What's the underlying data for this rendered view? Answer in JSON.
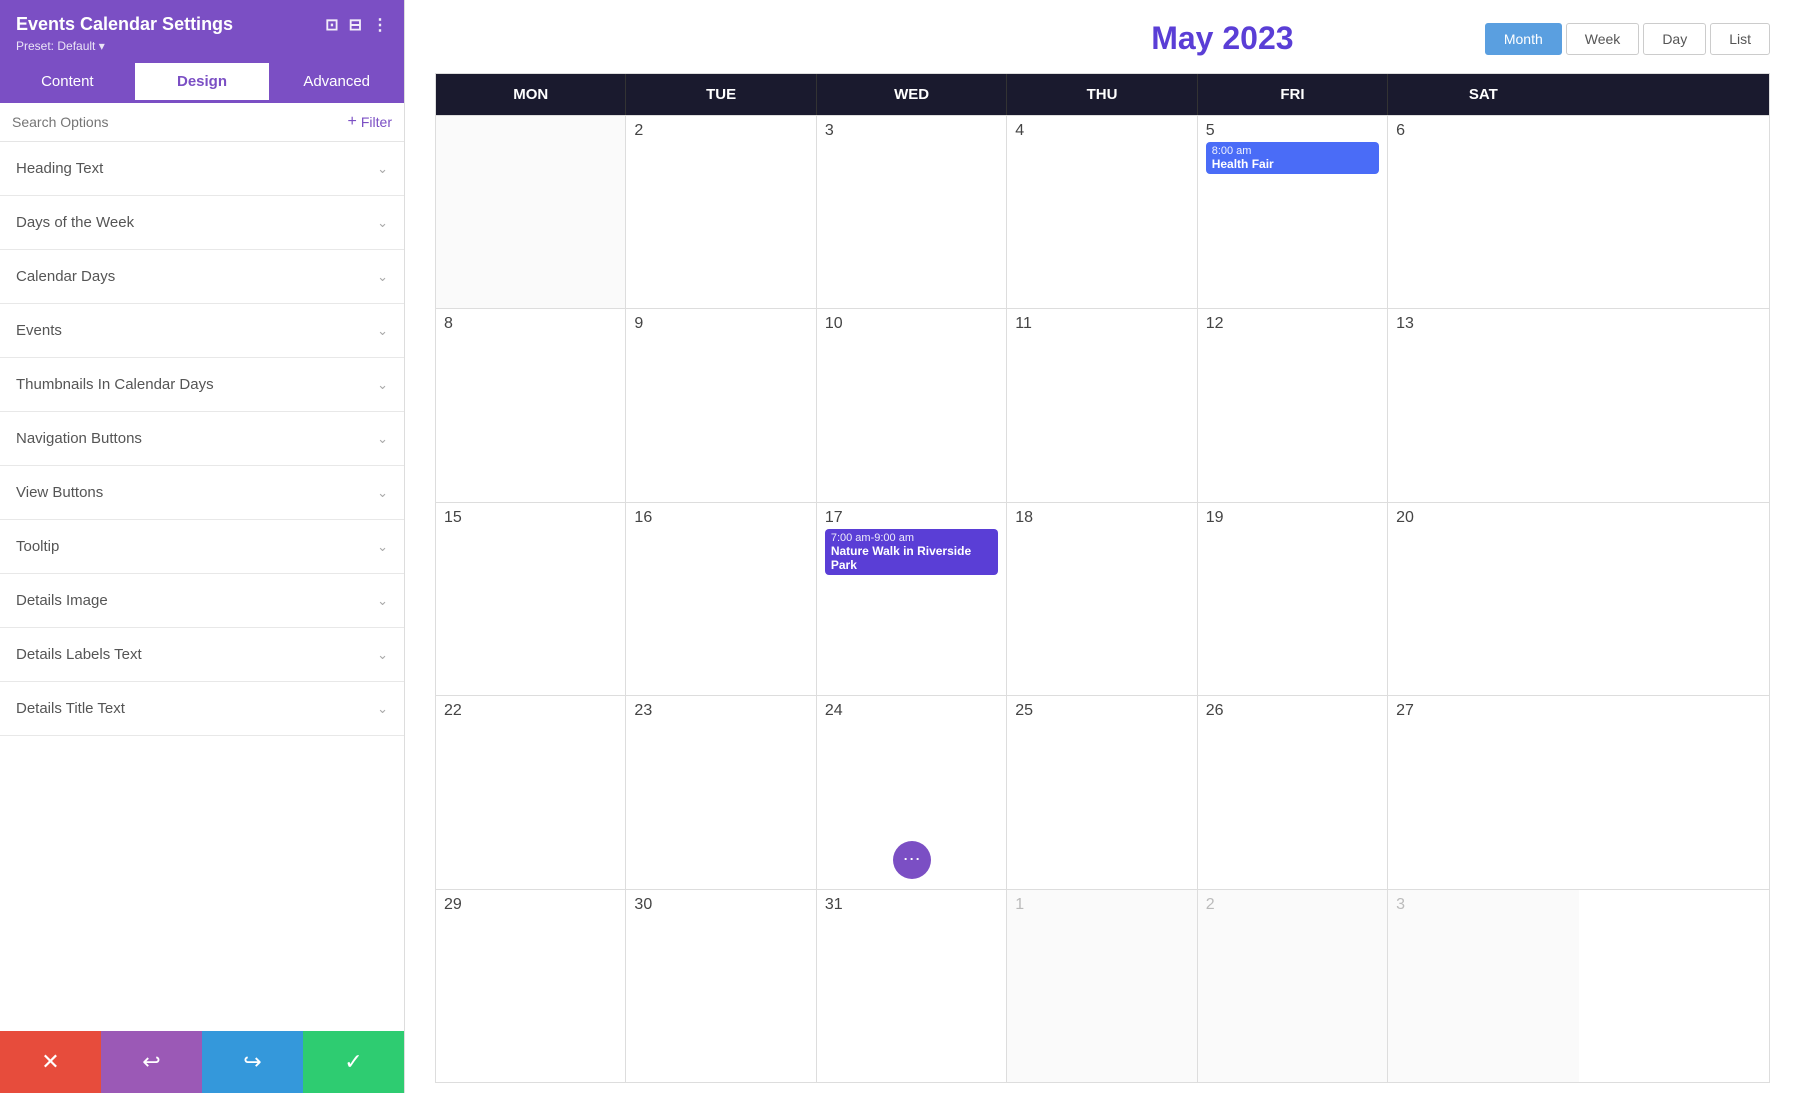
{
  "panel": {
    "title": "Events Calendar Settings",
    "preset_label": "Preset: Default",
    "icons": {
      "responsive": "⊡",
      "layout": "⊟",
      "more": "⋮"
    }
  },
  "tabs": [
    {
      "id": "content",
      "label": "Content",
      "active": false
    },
    {
      "id": "design",
      "label": "Design",
      "active": true
    },
    {
      "id": "advanced",
      "label": "Advanced",
      "active": false
    }
  ],
  "search": {
    "placeholder": "Search Options",
    "filter_label": "+ Filter"
  },
  "settings_items": [
    {
      "label": "Heading Text"
    },
    {
      "label": "Days of the Week"
    },
    {
      "label": "Calendar Days"
    },
    {
      "label": "Events"
    },
    {
      "label": "Thumbnails In Calendar Days"
    },
    {
      "label": "Navigation Buttons"
    },
    {
      "label": "View Buttons"
    },
    {
      "label": "Tooltip"
    },
    {
      "label": "Details Image"
    },
    {
      "label": "Details Labels Text"
    },
    {
      "label": "Details Title Text"
    }
  ],
  "toolbar": {
    "cancel_icon": "✕",
    "undo_icon": "↩",
    "redo_icon": "↪",
    "save_icon": "✓"
  },
  "calendar": {
    "title": "May 2023",
    "view_buttons": [
      {
        "label": "Month",
        "active": true
      },
      {
        "label": "Week",
        "active": false
      },
      {
        "label": "Day",
        "active": false
      },
      {
        "label": "List",
        "active": false
      }
    ],
    "day_headers": [
      "MON",
      "TUE",
      "WED",
      "THU",
      "FRI",
      "SAT"
    ],
    "rows": [
      {
        "cells": [
          {
            "date": "",
            "other_month": true,
            "events": []
          },
          {
            "date": "2",
            "other_month": false,
            "events": []
          },
          {
            "date": "3",
            "other_month": false,
            "events": []
          },
          {
            "date": "4",
            "other_month": false,
            "events": []
          },
          {
            "date": "5",
            "other_month": false,
            "events": [
              {
                "time": "8:00 am",
                "name": "Health Fair",
                "color": "blue"
              }
            ]
          },
          {
            "date": "6",
            "other_month": false,
            "events": []
          }
        ]
      },
      {
        "cells": [
          {
            "date": "8",
            "other_month": false,
            "events": []
          },
          {
            "date": "9",
            "other_month": false,
            "events": []
          },
          {
            "date": "10",
            "other_month": false,
            "events": []
          },
          {
            "date": "11",
            "other_month": false,
            "events": []
          },
          {
            "date": "12",
            "other_month": false,
            "events": []
          },
          {
            "date": "13",
            "other_month": false,
            "events": []
          }
        ]
      },
      {
        "cells": [
          {
            "date": "15",
            "other_month": false,
            "events": []
          },
          {
            "date": "16",
            "other_month": false,
            "events": []
          },
          {
            "date": "17",
            "other_month": false,
            "events": [
              {
                "time": "7:00 am-9:00 am",
                "name": "Nature Walk in Riverside Park",
                "color": "purple"
              }
            ]
          },
          {
            "date": "18",
            "other_month": false,
            "events": []
          },
          {
            "date": "19",
            "other_month": false,
            "events": []
          },
          {
            "date": "20",
            "other_month": false,
            "events": []
          }
        ]
      },
      {
        "cells": [
          {
            "date": "22",
            "other_month": false,
            "events": [],
            "has_dots": false
          },
          {
            "date": "23",
            "other_month": false,
            "events": []
          },
          {
            "date": "24",
            "other_month": false,
            "events": [],
            "has_dots": true
          },
          {
            "date": "25",
            "other_month": false,
            "events": []
          },
          {
            "date": "26",
            "other_month": false,
            "events": []
          },
          {
            "date": "27",
            "other_month": false,
            "events": []
          }
        ]
      },
      {
        "cells": [
          {
            "date": "29",
            "other_month": false,
            "events": []
          },
          {
            "date": "30",
            "other_month": false,
            "events": []
          },
          {
            "date": "31",
            "other_month": false,
            "events": []
          },
          {
            "date": "1",
            "other_month": true,
            "events": []
          },
          {
            "date": "2",
            "other_month": true,
            "events": []
          },
          {
            "date": "3",
            "other_month": true,
            "events": []
          }
        ]
      }
    ]
  },
  "colors": {
    "panel_header": "#7b4fc4",
    "active_tab_text": "#7b4fc4",
    "calendar_title": "#5a3ed6",
    "day_header_bg": "#1a1a2e",
    "event_blue": "#4a6cf7",
    "event_purple": "#5a3ed6",
    "month_btn_active": "#5a9fe0",
    "btn_cancel": "#e74c3c",
    "btn_undo": "#9b59b6",
    "btn_redo": "#3498db",
    "btn_save": "#2ecc71"
  }
}
